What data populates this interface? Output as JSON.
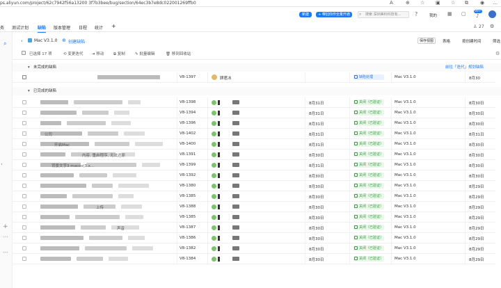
{
  "browser": {
    "url": "ps.aliyun.com/project/62c7942f56a13200 3f7b3bee/bug/section/64ec3b7e8dc022001269ffb0"
  },
  "header": {
    "new_btn": "新建",
    "promo_btn": "+ 带回你作全量开通",
    "search_placeholder": "搜索 深圳美科科技有...",
    "mine": "我的",
    "badge": "99+",
    "member_count": "27"
  },
  "tabs": [
    "务",
    "测试计划",
    "缺陷",
    "版本管理",
    "日程",
    "统计",
    "+"
  ],
  "title": {
    "label": "Mac V3.1.0",
    "create": "创建缺陷"
  },
  "toolbar": {
    "selected": "已选择 17 项",
    "items": [
      "变更迭代",
      "移动",
      "复制",
      "批量编辑",
      "移到回收站"
    ],
    "save_view": "保存视图",
    "table": "表格",
    "sort": "按创建时间",
    "filter": "筛选"
  },
  "groups": {
    "unfinished": "未完成的缺陷",
    "unfinished_link": "前往「迭代」规划缺陷",
    "finished": "已完成的缺陷"
  },
  "open_row": {
    "id": "V8-1397",
    "assignee": "顾君冰",
    "status": "缺陷处理",
    "version": "Mac V3.1.0",
    "date": "8月30"
  },
  "rows": [
    {
      "id": "V8-1398",
      "d1": "8月31日",
      "status": "关闭（已验证）",
      "version": "Mac V3.1.0",
      "d2": "8月30日"
    },
    {
      "id": "V8-1394",
      "d1": "8月31日",
      "status": "关闭（已验证）",
      "version": "Mac V3.1.0",
      "d2": "8月30日"
    },
    {
      "id": "V8-1396",
      "d1": "8月31日",
      "status": "关闭（已验证）",
      "version": "Mac V3.1.0",
      "d2": "8月30日"
    },
    {
      "id": "V8-1402",
      "d1": "8月31日",
      "status": "关闭（已验证）",
      "version": "Mac V3.1.0",
      "d2": "8月31日"
    },
    {
      "id": "V8-1400",
      "d1": "8月31日",
      "status": "关闭（已验证）",
      "version": "Mac V3.1.0",
      "d2": "8月30日"
    },
    {
      "id": "V8-1391",
      "d1": "8月30日",
      "status": "关闭（已验证）",
      "version": "Mac V3.1.0",
      "d2": "8月30日"
    },
    {
      "id": "V8-1399",
      "d1": "8月31日",
      "status": "关闭（已验证）",
      "version": "Mac V3.1.0",
      "d2": "8月30日"
    },
    {
      "id": "V8-1392",
      "d1": "8月30日",
      "status": "关闭（已验证）",
      "version": "Mac V3.1.0",
      "d2": "8月30日"
    },
    {
      "id": "V8-1380",
      "d1": "8月30日",
      "status": "关闭（已验证）",
      "version": "Mac V3.1.0",
      "d2": "8月29日"
    },
    {
      "id": "V8-1385",
      "d1": "8月30日",
      "status": "关闭（已验证）",
      "version": "Mac V3.1.0",
      "d2": "8月29日"
    },
    {
      "id": "V8-1388",
      "d1": "8月30日",
      "status": "关闭（已验证）",
      "version": "Mac V3.1.0",
      "d2": "8月29日"
    },
    {
      "id": "V8-1385",
      "d1": "8月30日",
      "status": "关闭（已验证）",
      "version": "Mac V3.1.0",
      "d2": "8月29日"
    },
    {
      "id": "V8-1387",
      "d1": "8月30日",
      "status": "关闭（已验证）",
      "version": "Mac V3.1.0",
      "d2": "8月29日"
    },
    {
      "id": "V8-1386",
      "d1": "8月30日",
      "status": "关闭（已验证）",
      "version": "Mac V3.1.0",
      "d2": "8月29日"
    },
    {
      "id": "V8-1382",
      "d1": "8月30日",
      "status": "关闭（已验证）",
      "version": "Mac V3.1.0",
      "d2": "8月29日"
    },
    {
      "id": "V8-1384",
      "d1": "8月30日",
      "status": "关闭（已验证）",
      "version": "Mac V3.1.0",
      "d2": "8月29日"
    }
  ],
  "snippets": [
    "公司",
    "开启Mac",
    "内容, 重启程序, 无法还原",
    "背景文字3 macos(3.x...",
    "上传",
    "声音"
  ],
  "colors": {
    "accent": "#1b7af8",
    "done": "#2e9e3e"
  }
}
